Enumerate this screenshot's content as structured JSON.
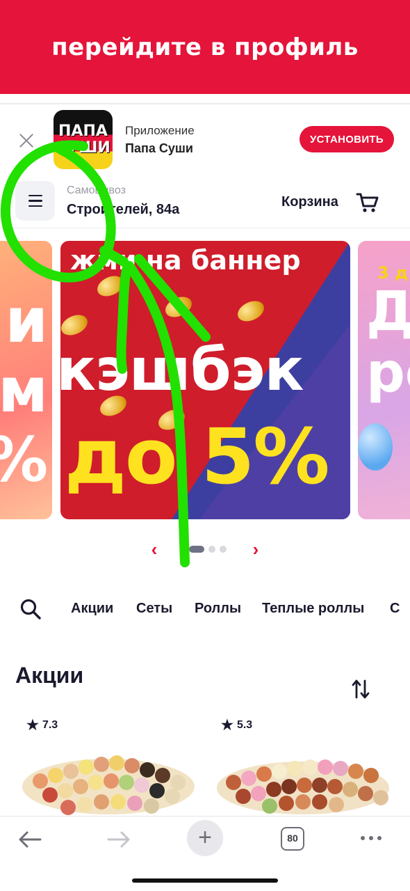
{
  "instruction": "перейдите в профиль",
  "app_banner": {
    "logo_line1": "ПАПА",
    "logo_line2": "СУШИ",
    "caption": "Приложение",
    "name": "Папа Суши",
    "install_label": "УСТАНОВИТЬ"
  },
  "header": {
    "pickup_label": "Самовывоз",
    "pickup_address": "Строителей, 84а",
    "cart_label": "Корзина"
  },
  "carousel": {
    "left_slide": {
      "line1": "и",
      "line2": "м",
      "line3": "%"
    },
    "main_slide": {
      "top": "жми на баннер",
      "line1": "кэшбэк",
      "line2": "до 5%"
    },
    "right_slide": {
      "small": "3 д",
      "line1": "Д",
      "line2": "ро"
    },
    "prev_symbol": "‹",
    "next_symbol": "›",
    "page_count": 3,
    "active_page": 1
  },
  "categories": [
    "Акции",
    "Сеты",
    "Роллы",
    "Теплые роллы",
    "С"
  ],
  "section": {
    "title": "Акции"
  },
  "products": [
    {
      "rating": "7.3"
    },
    {
      "rating": "5.3"
    }
  ],
  "browser": {
    "tab_count": "80"
  },
  "colors": {
    "brand_red": "#e5143a",
    "text_dark": "#1a1a2e",
    "annotation_green": "#22e000",
    "banner_yellow": "#ffe21f"
  },
  "icons": [
    "close-icon",
    "menu-icon",
    "cart-icon",
    "search-icon",
    "sort-icon",
    "star-icon",
    "back-arrow-icon",
    "forward-arrow-icon",
    "plus-icon",
    "more-icon"
  ]
}
